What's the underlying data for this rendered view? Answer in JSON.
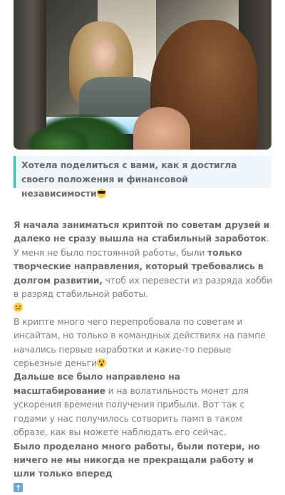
{
  "hero": {
    "image_alt": "girl applying makeup in front of a mirror"
  },
  "quote": {
    "text": "Хотела поделиться с вами, как я достигла своего положения и финансовой независимости",
    "emoji": "sunglasses-icon"
  },
  "article": {
    "p1_bold_a": "Я начала заниматься криптой по советам друзей и далеко не сразу вышла на стабильный заработок",
    "p1_text_a": ". У меня не было постоянной работы, были ",
    "p1_bold_b": "только творческие направления, который требовались в долгом развитии,",
    "p1_text_b": " чтоб их перевести из разряда хобби в разряд стабильной работы.",
    "p1_emoji": "sad-face-icon",
    "p2_text": "В крипте много чего перепробовала по советам и инсайтам, но только в командных действиях на пампе начались первые наработки и какие-то первые серьезные деньги",
    "p2_emoji": "surprised-face-icon",
    "p3_bold": "Дальше все было направлено на масштабирование",
    "p3_text": " и на волатильность монет для ускорения времени получения прибыли. Вот так с годами у нас получилось сотворить памп в таком образе, как вы можете наблюдать его сейчас.",
    "p4_bold": "Было проделано много работы, были потери, но ничего не мы никогда не прекращали работу и шли только вперед",
    "p4_emoji": "top-arrow-icon"
  }
}
